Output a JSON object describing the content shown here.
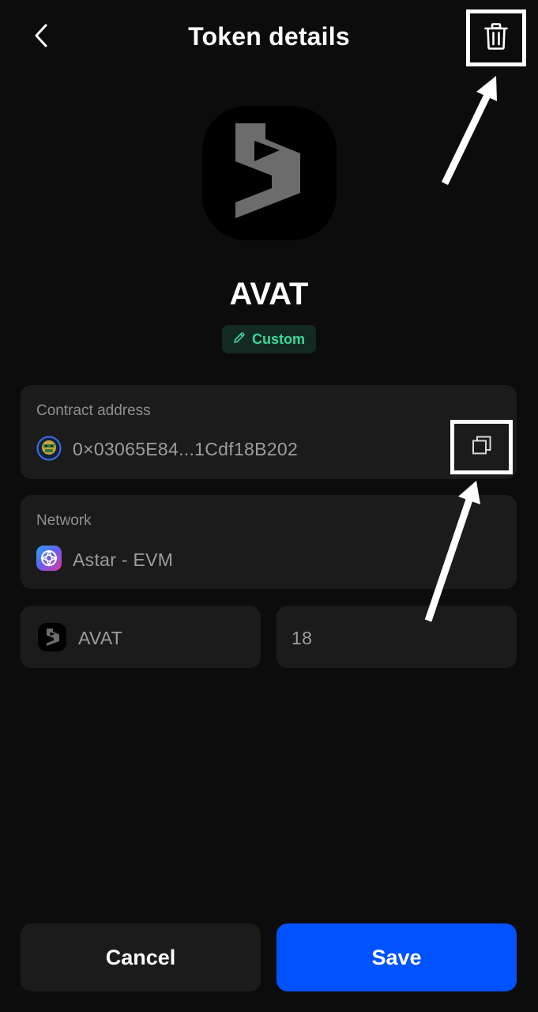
{
  "header": {
    "title": "Token details",
    "back_icon": "chevron-left-icon",
    "delete_icon": "trash-icon"
  },
  "token": {
    "symbol": "AVAT",
    "badge_label": "Custom",
    "badge_icon": "pencil-icon",
    "logo_icon": "avat-logo-icon"
  },
  "contract": {
    "label": "Contract address",
    "value": "0×03065E84...1Cdf18B202",
    "copy_icon": "copy-icon"
  },
  "network": {
    "label": "Network",
    "value": "Astar - EVM",
    "icon": "astar-network-icon"
  },
  "symbol_field": {
    "value": "AVAT"
  },
  "decimals_field": {
    "value": "18"
  },
  "buttons": {
    "cancel_label": "Cancel",
    "save_label": "Save"
  },
  "colors": {
    "background": "#0c0c0c",
    "card": "#1b1b1b",
    "accent": "#0052ff",
    "badge_text": "#3ed69c",
    "badge_bg": "#132a22"
  }
}
